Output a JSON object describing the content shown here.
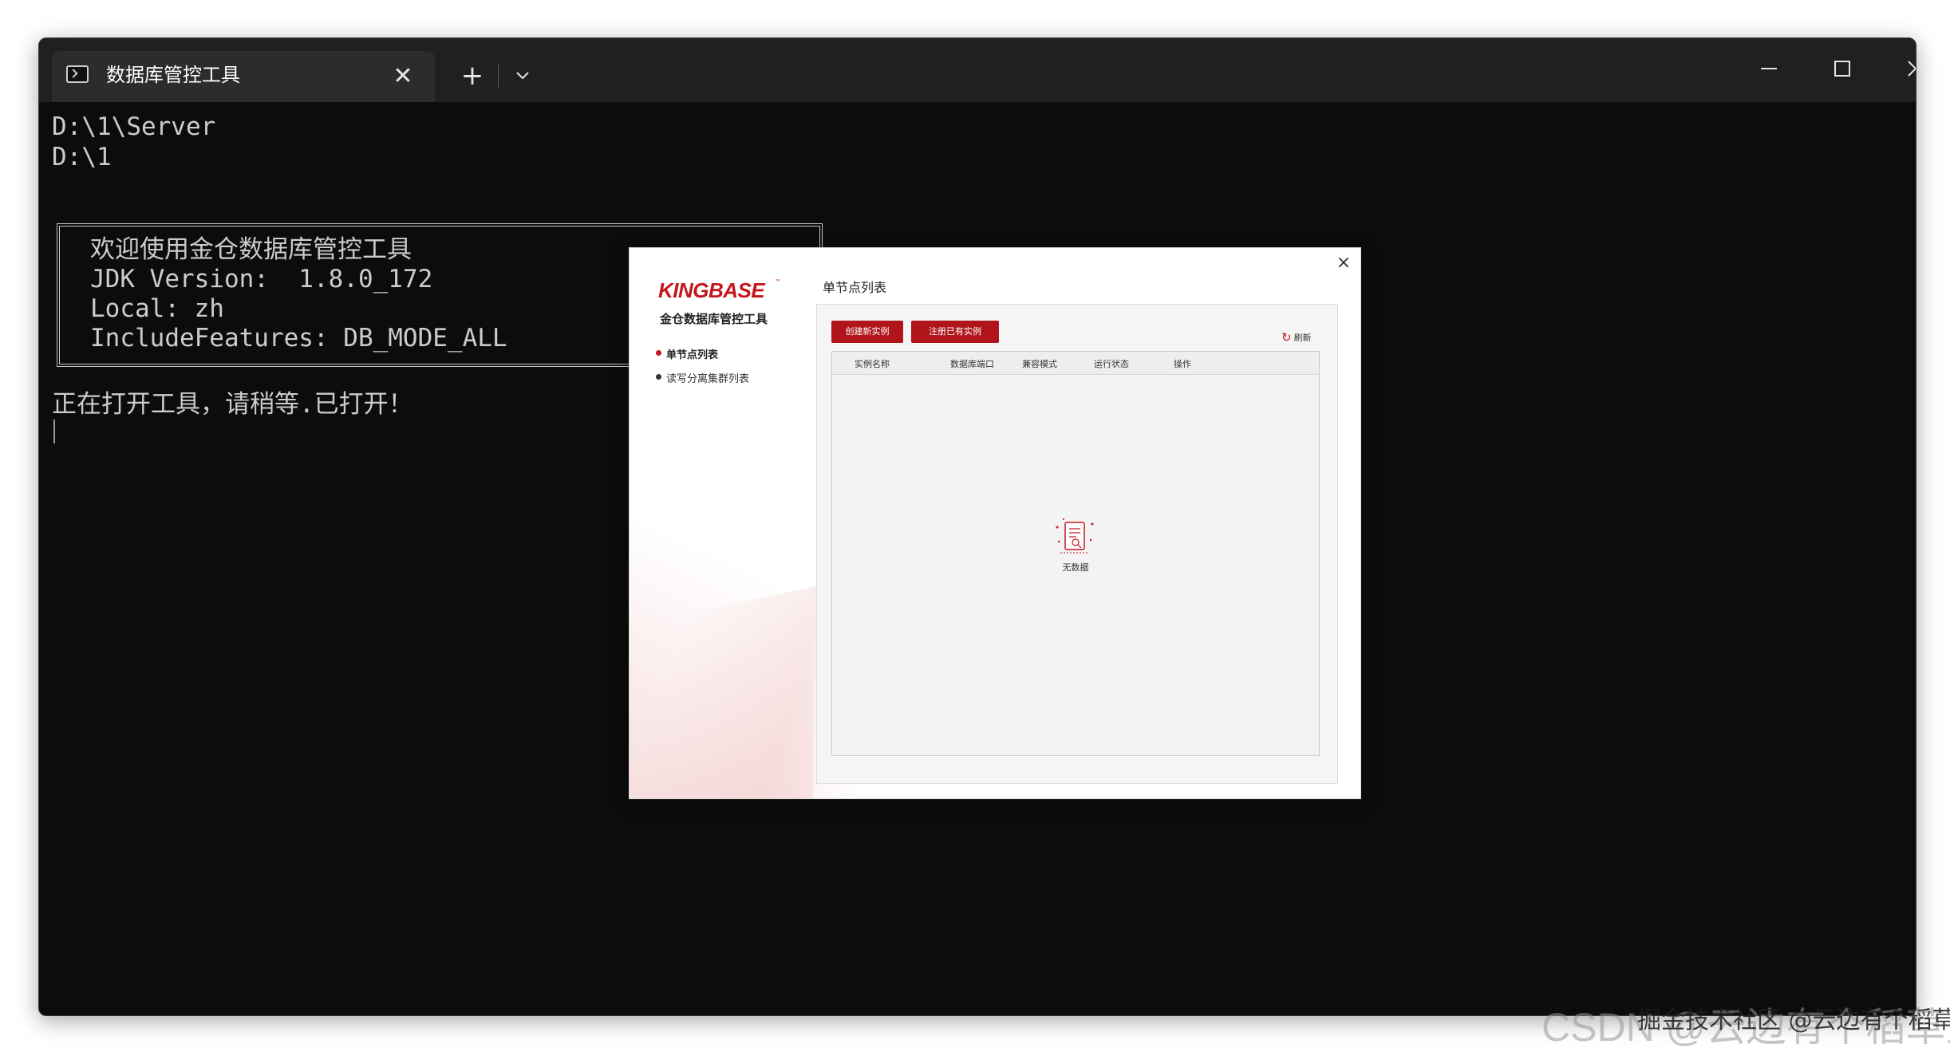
{
  "window": {
    "tab_title": "数据库管控工具",
    "close_tab_glyph": "✕",
    "new_tab_glyph": "+"
  },
  "terminal": {
    "lines": [
      "D:\\1\\Server",
      "D:\\1"
    ],
    "banner": [
      "欢迎使用金仓数据库管控工具",
      "JDK Version:  1.8.0_172",
      "Local: zh",
      "IncludeFeatures: DB_MODE_ALL"
    ],
    "status_line": "正在打开工具，请稍等.已打开！"
  },
  "app": {
    "close_glyph": "×",
    "logo": "KINGBASE",
    "logo_tm": "™",
    "app_name": "金仓数据库管控工具",
    "nav": [
      "单节点列表",
      "读写分离集群列表"
    ],
    "main_title": "单节点列表",
    "buttons": {
      "create": "创建新实例",
      "register": "注册已有实例",
      "refresh": "刷新"
    },
    "table": {
      "columns": [
        "实例名称",
        "数据库端口",
        "兼容模式",
        "运行状态",
        "操作"
      ],
      "empty_text": "无数据"
    },
    "colors": {
      "brand": "#c4161c",
      "button": "#b0151b"
    }
  },
  "watermark": {
    "primary": "CSDN @云边有个稻草人",
    "secondary": "掘金技术社区 @云边有个稻草人"
  }
}
